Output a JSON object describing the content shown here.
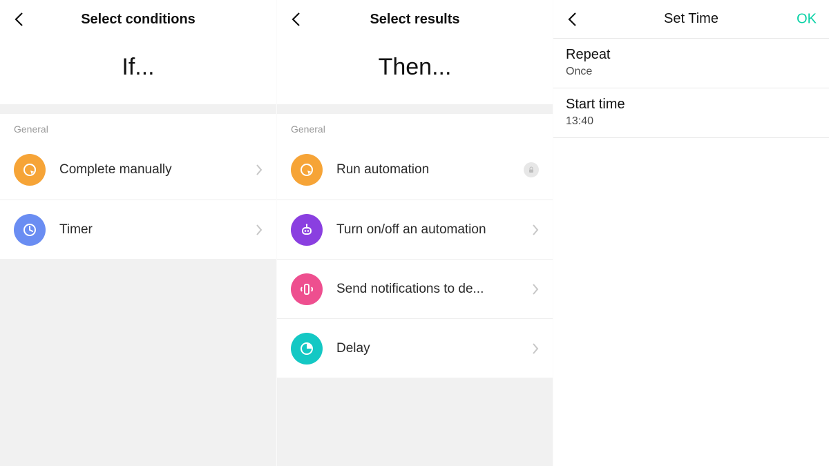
{
  "pane1": {
    "header_title": "Select conditions",
    "big": "If...",
    "section": "General",
    "items": [
      {
        "label": "Complete manually"
      },
      {
        "label": "Timer"
      }
    ]
  },
  "pane2": {
    "header_title": "Select results",
    "big": "Then...",
    "section": "General",
    "items": [
      {
        "label": "Run automation"
      },
      {
        "label": "Turn on/off an automation"
      },
      {
        "label": "Send notifications to de..."
      },
      {
        "label": "Delay"
      }
    ]
  },
  "pane3": {
    "header_title": "Set Time",
    "ok": "OK",
    "rows": [
      {
        "title": "Repeat",
        "value": "Once"
      },
      {
        "title": "Start time",
        "value": "13:40"
      }
    ]
  },
  "colors": {
    "orange": "#f6a437",
    "blue": "#6a8df2",
    "purple": "#8a3fe0",
    "pink": "#ee4f8f",
    "teal": "#14c8c4",
    "ok": "#0ad2a6"
  }
}
